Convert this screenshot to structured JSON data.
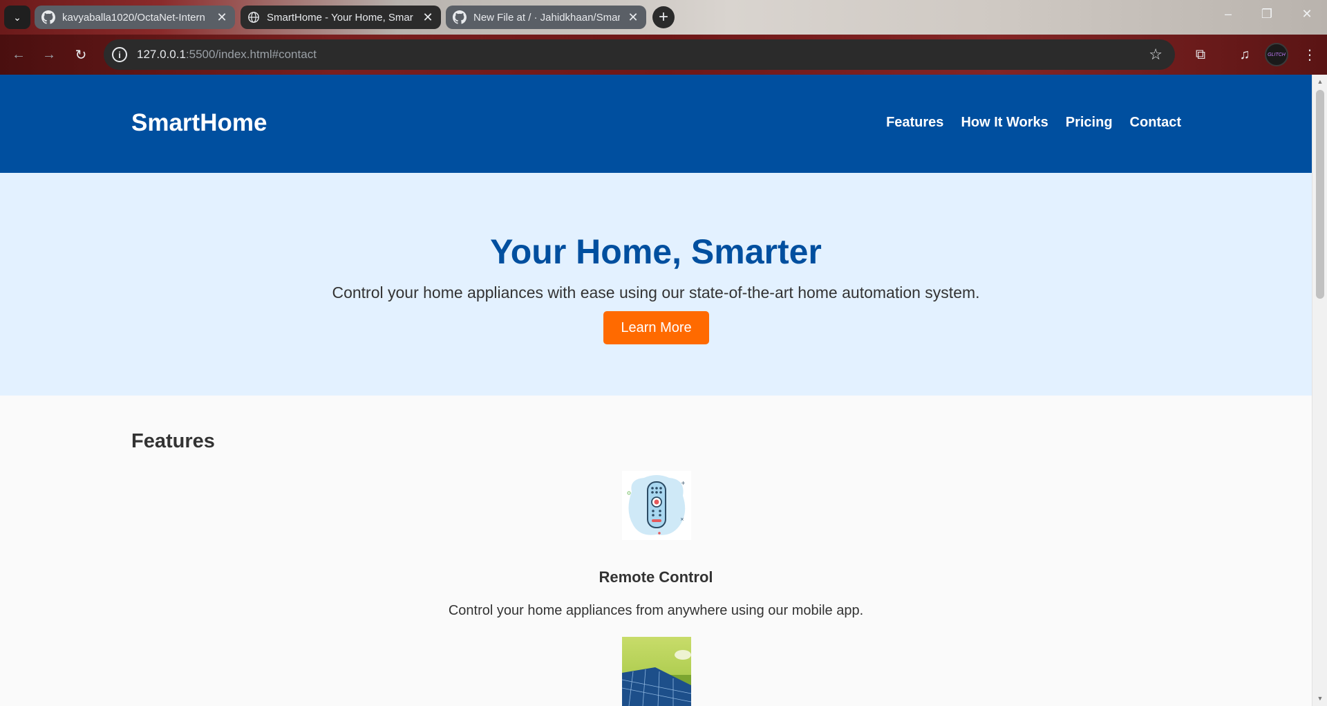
{
  "browser": {
    "tabs": [
      {
        "title": "kavyaballa1020/OctaNet-Intern",
        "icon": "github-icon",
        "active": false
      },
      {
        "title": "SmartHome - Your Home, Smar",
        "icon": "globe-icon",
        "active": true
      },
      {
        "title": "New File at / · Jahidkhaan/Smar",
        "icon": "github-icon",
        "active": false
      }
    ],
    "url_host": "127.0.0.1",
    "url_rest": ":5500/index.html#contact",
    "profile_label": "GLITCH"
  },
  "site": {
    "logo": "SmartHome",
    "nav": [
      "Features",
      "How It Works",
      "Pricing",
      "Contact"
    ],
    "hero": {
      "title": "Your Home, Smarter",
      "subtitle": "Control your home appliances with ease using our state-of-the-art home automation system.",
      "cta": "Learn More"
    },
    "features_title": "Features",
    "features": [
      {
        "name": "Remote Control",
        "description": "Control your home appliances from anywhere using our mobile app.",
        "image": "remote-control-illustration"
      },
      {
        "name": "",
        "description": "",
        "image": "solar-panel-photo"
      }
    ]
  },
  "colors": {
    "header_blue": "#004f9f",
    "hero_bg": "#e3f1ff",
    "cta_orange": "#ff6a00"
  }
}
